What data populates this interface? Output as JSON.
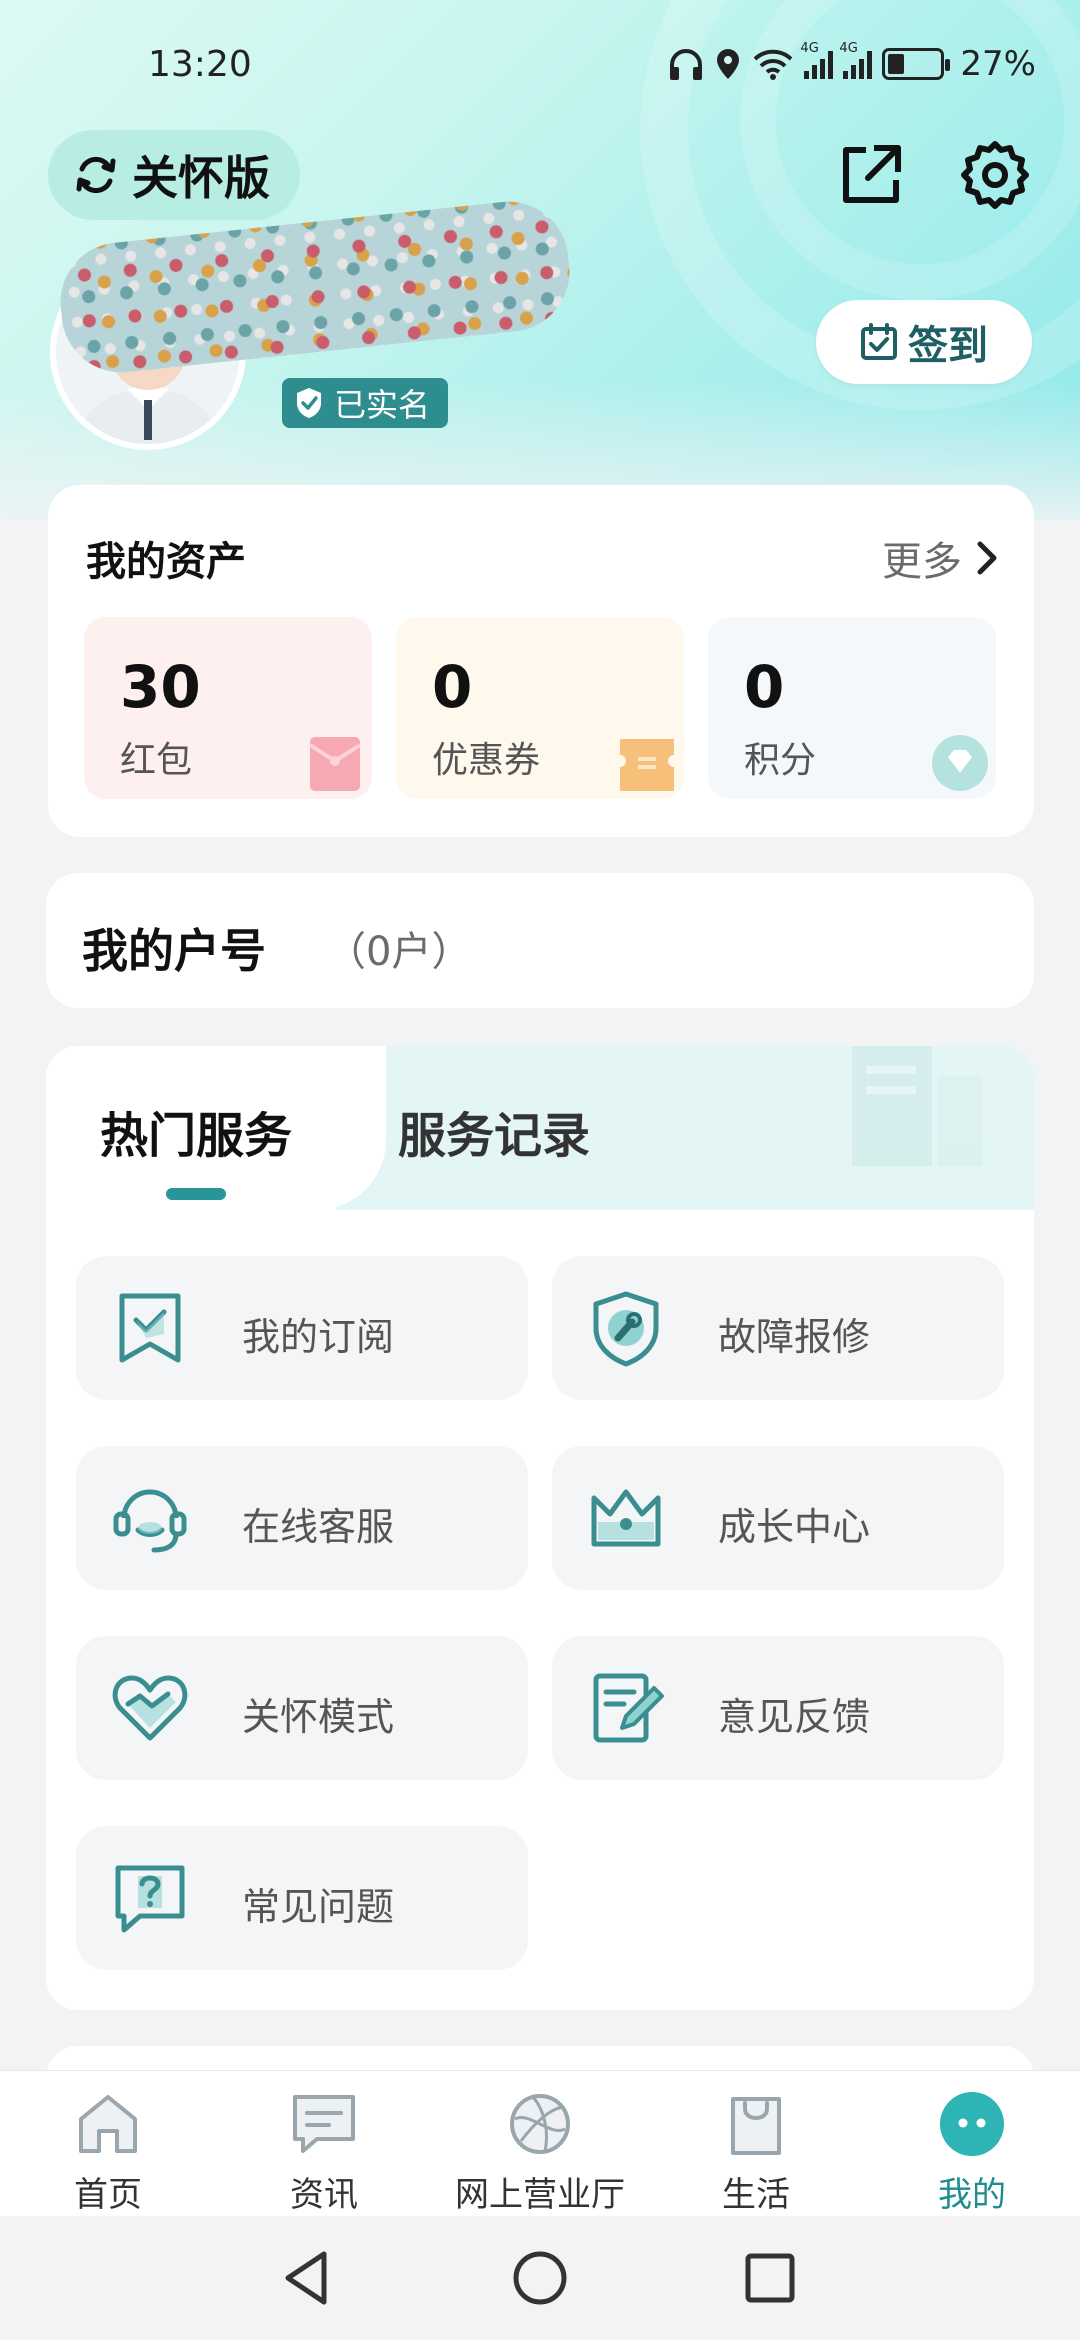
{
  "status_bar": {
    "time": "13:20",
    "network_1": "4G",
    "network_2": "4G",
    "battery": "27%",
    "icons": [
      "headphones-icon",
      "location-icon",
      "wifi-icon",
      "signal-icon",
      "battery-icon"
    ]
  },
  "header": {
    "care_mode_label": "关怀版",
    "verified_label": "已实名",
    "checkin_label": "签到",
    "icons": [
      "refresh-icon",
      "share-icon",
      "settings-icon",
      "calendar-icon"
    ]
  },
  "assets": {
    "title": "我的资产",
    "more_label": "更多",
    "items": [
      {
        "value": "30",
        "label": "红包",
        "icon": "red-packet-icon",
        "bg": "#fff0f0",
        "accent": "#f6a9b3"
      },
      {
        "value": "0",
        "label": "优惠券",
        "icon": "coupon-icon",
        "bg": "#fff8ec",
        "accent": "#f7c07a"
      },
      {
        "value": "0",
        "label": "积分",
        "icon": "points-diamond-icon",
        "bg": "#f4f8fb",
        "accent": "#b3e2df"
      }
    ]
  },
  "account": {
    "title": "我的户号",
    "count": "（0户）"
  },
  "services": {
    "tabs": [
      {
        "label": "热门服务",
        "active": true
      },
      {
        "label": "服务记录",
        "active": false
      }
    ],
    "items": [
      {
        "label": "我的订阅",
        "icon": "subscription-icon"
      },
      {
        "label": "故障报修",
        "icon": "repair-icon"
      },
      {
        "label": "在线客服",
        "icon": "customer-service-icon"
      },
      {
        "label": "成长中心",
        "icon": "crown-icon"
      },
      {
        "label": "关怀模式",
        "icon": "care-heart-icon"
      },
      {
        "label": "意见反馈",
        "icon": "feedback-icon"
      },
      {
        "label": "常见问题",
        "icon": "faq-icon"
      }
    ]
  },
  "bottom_nav": {
    "items": [
      {
        "label": "首页",
        "icon": "home-icon",
        "active": false
      },
      {
        "label": "资讯",
        "icon": "news-icon",
        "active": false
      },
      {
        "label": "网上营业厅",
        "icon": "online-hall-icon",
        "active": false
      },
      {
        "label": "生活",
        "icon": "life-bag-icon",
        "active": false
      },
      {
        "label": "我的",
        "icon": "mine-icon",
        "active": true
      }
    ]
  },
  "colors": {
    "accent": "#2a9596",
    "active_nav": "#1d8d8f",
    "verified_badge": "#2e8e8f",
    "page_bg": "#f1f3f5"
  }
}
